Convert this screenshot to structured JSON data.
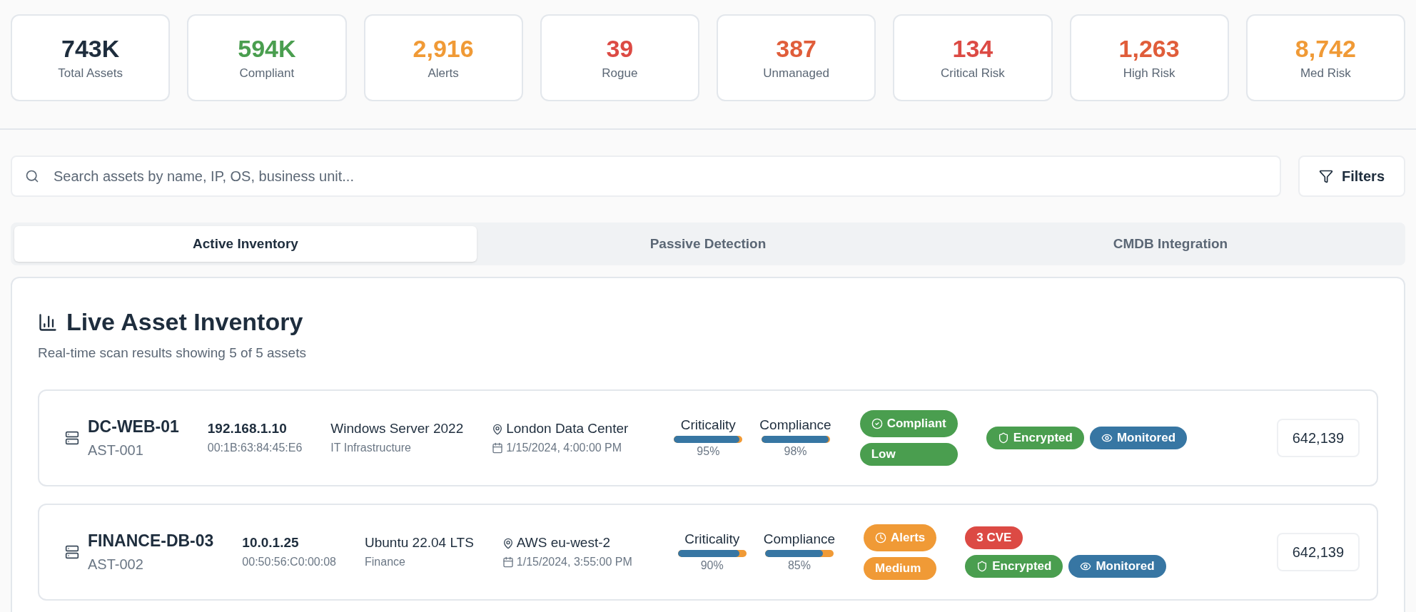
{
  "stats": [
    {
      "value": "743K",
      "label": "Total Assets",
      "color": "#1e2d3d"
    },
    {
      "value": "594K",
      "label": "Compliant",
      "color": "#4a9e4f"
    },
    {
      "value": "2,916",
      "label": "Alerts",
      "color": "#f09a36"
    },
    {
      "value": "39",
      "label": "Rogue",
      "color": "#dc4a44"
    },
    {
      "value": "387",
      "label": "Unmanaged",
      "color": "#e05d3a"
    },
    {
      "value": "134",
      "label": "Critical Risk",
      "color": "#dc4a44"
    },
    {
      "value": "1,263",
      "label": "High Risk",
      "color": "#e05d3a"
    },
    {
      "value": "8,742",
      "label": "Med Risk",
      "color": "#f09a36"
    }
  ],
  "search": {
    "placeholder": "Search assets by name, IP, OS, business unit..."
  },
  "filters_button": "Filters",
  "tabs": [
    {
      "label": "Active Inventory",
      "selected": true
    },
    {
      "label": "Passive Detection",
      "selected": false
    },
    {
      "label": "CMDB Integration",
      "selected": false
    }
  ],
  "panel": {
    "title": "Live Asset Inventory",
    "subtitle": "Real-time scan results showing 5 of 5 assets",
    "assets": [
      {
        "name": "DC-WEB-01",
        "id": "AST-001",
        "ip": "192.168.1.10",
        "mac": "00:1B:63:84:45:E6",
        "os": "Windows Server 2022",
        "unit": "IT Infrastructure",
        "location": "London Data Center",
        "date": "1/15/2024, 4:00:00 PM",
        "meters": [
          {
            "label": "Criticality",
            "level": 0.95,
            "reading": "95%"
          },
          {
            "label": "Compliance",
            "level": 0.98,
            "reading": "98%"
          }
        ],
        "status": {
          "kind": "compliant",
          "label": "Compliant",
          "color": "#4a9e4f"
        },
        "risk": {
          "label": "Low",
          "color": "#4a9e4f"
        },
        "tags": [
          {
            "kind": "encrypted",
            "label": "Encrypted",
            "color": "#4a9e4f"
          },
          {
            "kind": "monitored",
            "label": "Monitored",
            "color": "#3776a3"
          }
        ],
        "count": "642,139"
      },
      {
        "name": "FINANCE-DB-03",
        "id": "AST-002",
        "ip": "10.0.1.25",
        "mac": "00:50:56:C0:00:08",
        "os": "Ubuntu 22.04 LTS",
        "unit": "Finance",
        "location": "AWS eu-west-2",
        "date": "1/15/2024, 3:55:00 PM",
        "meters": [
          {
            "label": "Criticality",
            "level": 0.9,
            "reading": "90%"
          },
          {
            "label": "Compliance",
            "level": 0.85,
            "reading": "85%"
          }
        ],
        "status": {
          "kind": "alerts",
          "label": "Alerts",
          "color": "#f09a36"
        },
        "risk": {
          "label": "Medium",
          "color": "#f09a36"
        },
        "cve": {
          "label": "3 CVE",
          "color": "#dc4a44"
        },
        "tags": [
          {
            "kind": "encrypted",
            "label": "Encrypted",
            "color": "#4a9e4f"
          },
          {
            "kind": "monitored",
            "label": "Monitored",
            "color": "#3776a3"
          }
        ],
        "count": "642,139"
      }
    ]
  }
}
